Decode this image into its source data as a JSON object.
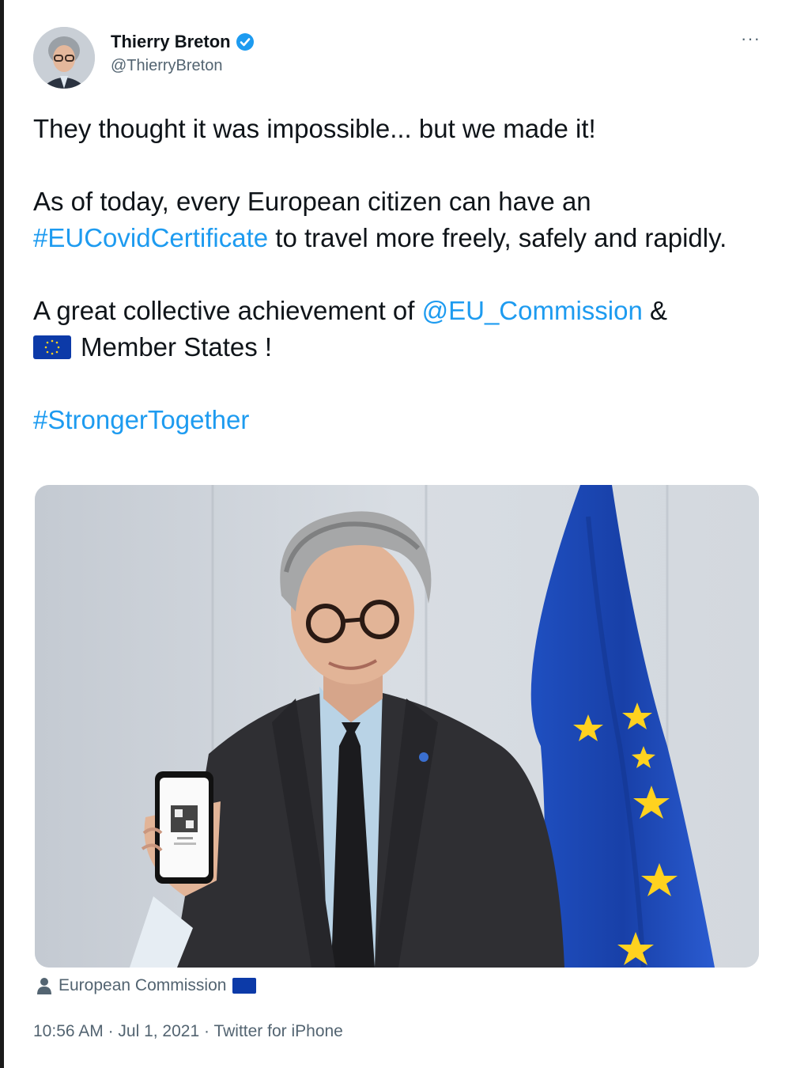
{
  "author": {
    "display_name": "Thierry Breton",
    "handle": "@ThierryBreton",
    "verified": true,
    "verified_icon": "verified-badge-icon"
  },
  "more_label": "···",
  "tweet": {
    "line1": "They thought it was impossible... but we made it!",
    "p2_before": "As of today, every European citizen can have an ",
    "p2_hashtag": "#EUCovidCertificate",
    "p2_after": " to travel more freely, safely and rapidly.",
    "p3_before": "A great collective achievement of ",
    "p3_mention": "@EU_Commission",
    "p3_after": " &",
    "p3_line2": "Member States !",
    "hashtag2": "#StrongerTogether"
  },
  "media": {
    "tagged_user": "European Commission",
    "tag_icon": "person-icon"
  },
  "meta": {
    "time": "10:56 AM",
    "date": "Jul 1, 2021",
    "source": "Twitter for iPhone",
    "separator": " · "
  },
  "colors": {
    "link": "#1d9bf0",
    "text": "#0f1419",
    "secondary": "#536471",
    "eu_blue": "#0c3aa8",
    "eu_yellow": "#ffd21f"
  }
}
